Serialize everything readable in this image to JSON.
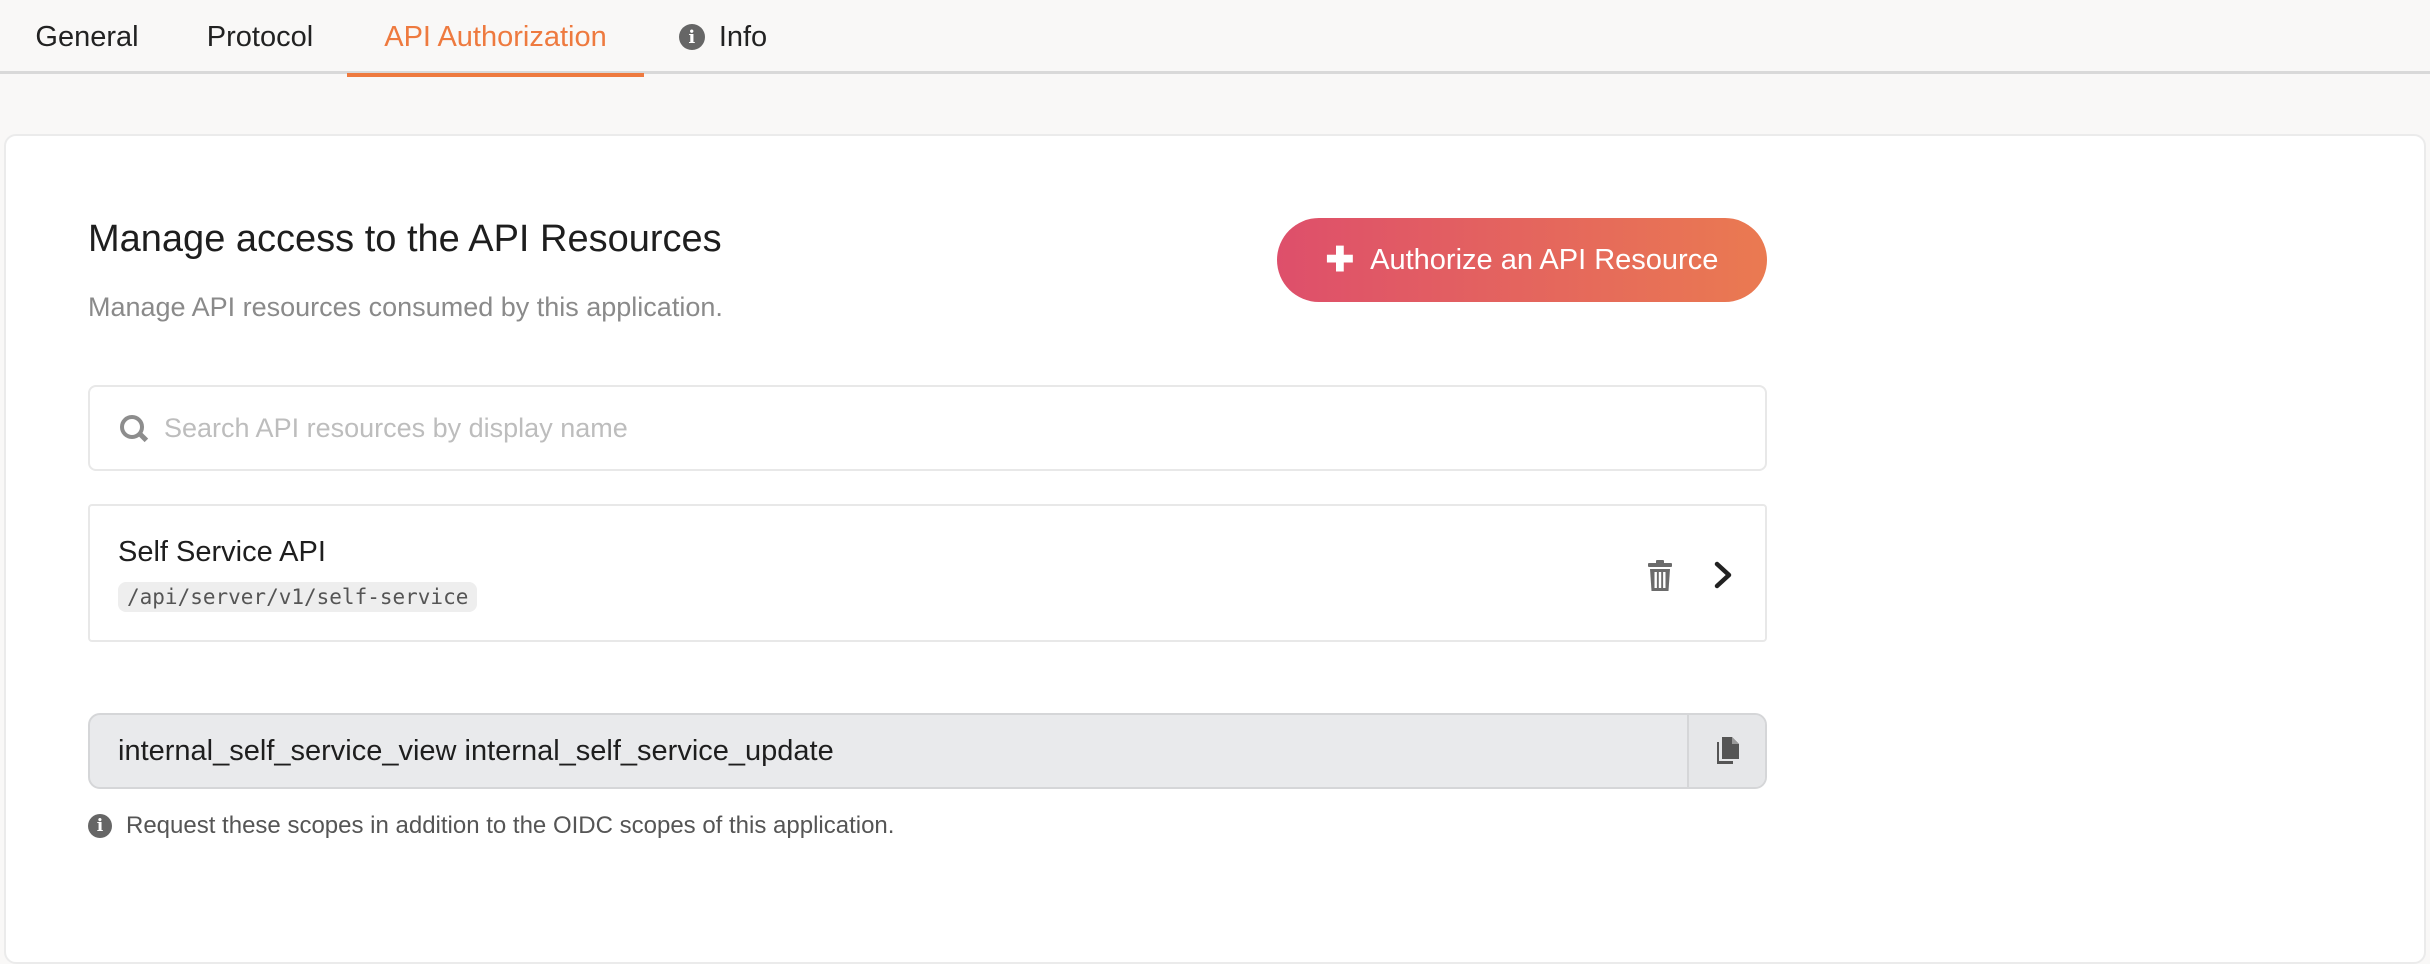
{
  "tabs": [
    {
      "label": "General",
      "active": false
    },
    {
      "label": "Protocol",
      "active": false
    },
    {
      "label": "API Authorization",
      "active": true
    },
    {
      "label": "Info",
      "active": false
    }
  ],
  "section": {
    "title": "Manage access to the API Resources",
    "subtitle": "Manage API resources consumed by this application.",
    "authorize_button_label": "Authorize an API Resource"
  },
  "search": {
    "placeholder": "Search API resources by display name",
    "value": ""
  },
  "resources": [
    {
      "name": "Self Service API",
      "identifier": "/api/server/v1/self-service"
    }
  ],
  "scopes": {
    "value": "internal_self_service_view internal_self_service_update",
    "hint": "Request these scopes in addition to the OIDC scopes of this application."
  },
  "colors": {
    "accent": "#ee7a3f",
    "button_gradient_start": "#de4f6b",
    "button_gradient_end": "#ea7a51"
  }
}
